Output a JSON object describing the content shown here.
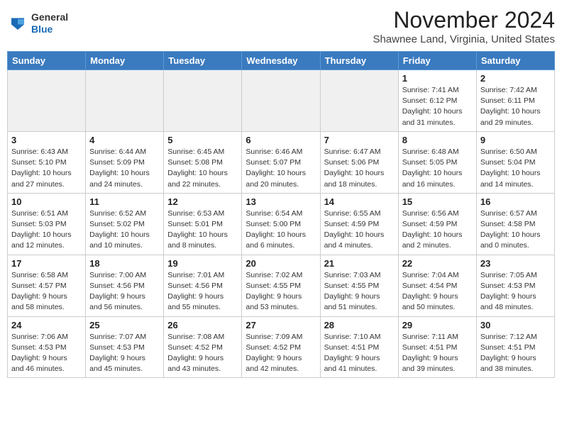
{
  "header": {
    "logo_line1": "General",
    "logo_line2": "Blue",
    "month": "November 2024",
    "location": "Shawnee Land, Virginia, United States"
  },
  "days_of_week": [
    "Sunday",
    "Monday",
    "Tuesday",
    "Wednesday",
    "Thursday",
    "Friday",
    "Saturday"
  ],
  "weeks": [
    [
      {
        "day": "",
        "info": "",
        "empty": true
      },
      {
        "day": "",
        "info": "",
        "empty": true
      },
      {
        "day": "",
        "info": "",
        "empty": true
      },
      {
        "day": "",
        "info": "",
        "empty": true
      },
      {
        "day": "",
        "info": "",
        "empty": true
      },
      {
        "day": "1",
        "info": "Sunrise: 7:41 AM\nSunset: 6:12 PM\nDaylight: 10 hours\nand 31 minutes."
      },
      {
        "day": "2",
        "info": "Sunrise: 7:42 AM\nSunset: 6:11 PM\nDaylight: 10 hours\nand 29 minutes."
      }
    ],
    [
      {
        "day": "3",
        "info": "Sunrise: 6:43 AM\nSunset: 5:10 PM\nDaylight: 10 hours\nand 27 minutes."
      },
      {
        "day": "4",
        "info": "Sunrise: 6:44 AM\nSunset: 5:09 PM\nDaylight: 10 hours\nand 24 minutes."
      },
      {
        "day": "5",
        "info": "Sunrise: 6:45 AM\nSunset: 5:08 PM\nDaylight: 10 hours\nand 22 minutes."
      },
      {
        "day": "6",
        "info": "Sunrise: 6:46 AM\nSunset: 5:07 PM\nDaylight: 10 hours\nand 20 minutes."
      },
      {
        "day": "7",
        "info": "Sunrise: 6:47 AM\nSunset: 5:06 PM\nDaylight: 10 hours\nand 18 minutes."
      },
      {
        "day": "8",
        "info": "Sunrise: 6:48 AM\nSunset: 5:05 PM\nDaylight: 10 hours\nand 16 minutes."
      },
      {
        "day": "9",
        "info": "Sunrise: 6:50 AM\nSunset: 5:04 PM\nDaylight: 10 hours\nand 14 minutes."
      }
    ],
    [
      {
        "day": "10",
        "info": "Sunrise: 6:51 AM\nSunset: 5:03 PM\nDaylight: 10 hours\nand 12 minutes."
      },
      {
        "day": "11",
        "info": "Sunrise: 6:52 AM\nSunset: 5:02 PM\nDaylight: 10 hours\nand 10 minutes."
      },
      {
        "day": "12",
        "info": "Sunrise: 6:53 AM\nSunset: 5:01 PM\nDaylight: 10 hours\nand 8 minutes."
      },
      {
        "day": "13",
        "info": "Sunrise: 6:54 AM\nSunset: 5:00 PM\nDaylight: 10 hours\nand 6 minutes."
      },
      {
        "day": "14",
        "info": "Sunrise: 6:55 AM\nSunset: 4:59 PM\nDaylight: 10 hours\nand 4 minutes."
      },
      {
        "day": "15",
        "info": "Sunrise: 6:56 AM\nSunset: 4:59 PM\nDaylight: 10 hours\nand 2 minutes."
      },
      {
        "day": "16",
        "info": "Sunrise: 6:57 AM\nSunset: 4:58 PM\nDaylight: 10 hours\nand 0 minutes."
      }
    ],
    [
      {
        "day": "17",
        "info": "Sunrise: 6:58 AM\nSunset: 4:57 PM\nDaylight: 9 hours\nand 58 minutes."
      },
      {
        "day": "18",
        "info": "Sunrise: 7:00 AM\nSunset: 4:56 PM\nDaylight: 9 hours\nand 56 minutes."
      },
      {
        "day": "19",
        "info": "Sunrise: 7:01 AM\nSunset: 4:56 PM\nDaylight: 9 hours\nand 55 minutes."
      },
      {
        "day": "20",
        "info": "Sunrise: 7:02 AM\nSunset: 4:55 PM\nDaylight: 9 hours\nand 53 minutes."
      },
      {
        "day": "21",
        "info": "Sunrise: 7:03 AM\nSunset: 4:55 PM\nDaylight: 9 hours\nand 51 minutes."
      },
      {
        "day": "22",
        "info": "Sunrise: 7:04 AM\nSunset: 4:54 PM\nDaylight: 9 hours\nand 50 minutes."
      },
      {
        "day": "23",
        "info": "Sunrise: 7:05 AM\nSunset: 4:53 PM\nDaylight: 9 hours\nand 48 minutes."
      }
    ],
    [
      {
        "day": "24",
        "info": "Sunrise: 7:06 AM\nSunset: 4:53 PM\nDaylight: 9 hours\nand 46 minutes."
      },
      {
        "day": "25",
        "info": "Sunrise: 7:07 AM\nSunset: 4:53 PM\nDaylight: 9 hours\nand 45 minutes."
      },
      {
        "day": "26",
        "info": "Sunrise: 7:08 AM\nSunset: 4:52 PM\nDaylight: 9 hours\nand 43 minutes."
      },
      {
        "day": "27",
        "info": "Sunrise: 7:09 AM\nSunset: 4:52 PM\nDaylight: 9 hours\nand 42 minutes."
      },
      {
        "day": "28",
        "info": "Sunrise: 7:10 AM\nSunset: 4:51 PM\nDaylight: 9 hours\nand 41 minutes."
      },
      {
        "day": "29",
        "info": "Sunrise: 7:11 AM\nSunset: 4:51 PM\nDaylight: 9 hours\nand 39 minutes."
      },
      {
        "day": "30",
        "info": "Sunrise: 7:12 AM\nSunset: 4:51 PM\nDaylight: 9 hours\nand 38 minutes."
      }
    ]
  ]
}
